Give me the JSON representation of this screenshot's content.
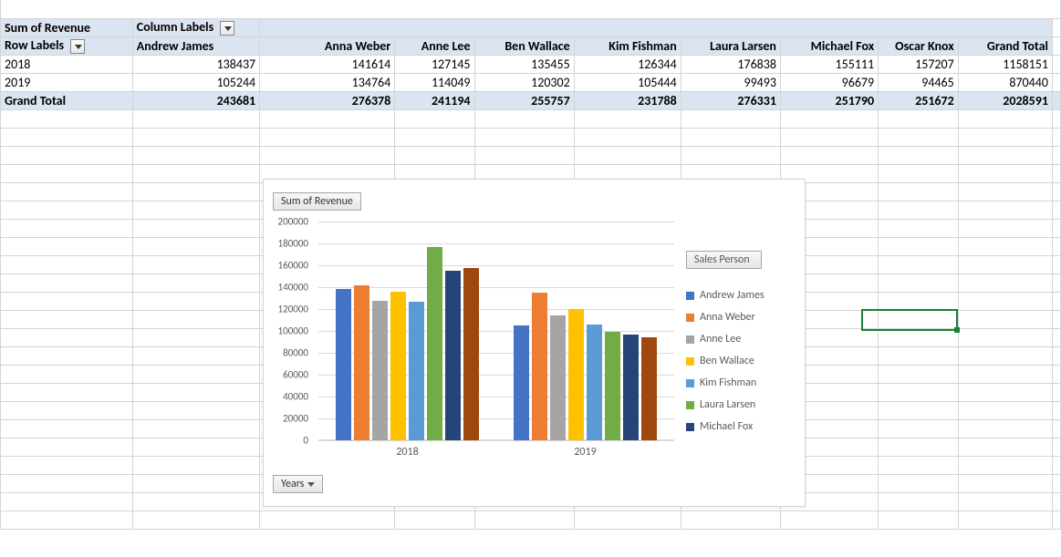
{
  "pivot": {
    "corner_label": "Sum of Revenue",
    "column_labels_header": "Column Labels",
    "row_labels_header": "Row Labels",
    "columns": [
      "Andrew James",
      "Anna Weber",
      "Anne Lee",
      "Ben Wallace",
      "Kim Fishman",
      "Laura Larsen",
      "Michael Fox",
      "Oscar Knox",
      "Grand Total"
    ],
    "rows": [
      {
        "label": "2018",
        "values": [
          138437,
          141614,
          127145,
          135455,
          126344,
          176838,
          155111,
          157207,
          1158151
        ]
      },
      {
        "label": "2019",
        "values": [
          105244,
          134764,
          114049,
          120302,
          105444,
          99493,
          96679,
          94465,
          870440
        ]
      }
    ],
    "grand_total_label": "Grand Total",
    "grand_total_values": [
      243681,
      276378,
      241194,
      255757,
      231788,
      276331,
      251790,
      251672,
      2028591
    ]
  },
  "chart_ui": {
    "value_field_button": "Sum of Revenue",
    "axis_field_button": "Years",
    "legend_header": "Sales Person"
  },
  "chart_data": {
    "type": "bar",
    "categories": [
      "2018",
      "2019"
    ],
    "series": [
      {
        "name": "Andrew James",
        "color": "#4472c4",
        "values": [
          138437,
          105244
        ]
      },
      {
        "name": "Anna Weber",
        "color": "#ed7d31",
        "values": [
          141614,
          134764
        ]
      },
      {
        "name": "Anne Lee",
        "color": "#a5a5a5",
        "values": [
          127145,
          114049
        ]
      },
      {
        "name": "Ben Wallace",
        "color": "#ffc000",
        "values": [
          135455,
          120302
        ]
      },
      {
        "name": "Kim Fishman",
        "color": "#5b9bd5",
        "values": [
          126344,
          105444
        ]
      },
      {
        "name": "Laura Larsen",
        "color": "#70ad47",
        "values": [
          176838,
          99493
        ]
      },
      {
        "name": "Michael Fox",
        "color": "#264478",
        "values": [
          155111,
          96679
        ]
      },
      {
        "name": "Oscar Knox",
        "color": "#9e480e",
        "values": [
          157207,
          94465
        ]
      }
    ],
    "ylim": [
      0,
      200000
    ],
    "ystep": 20000,
    "legend_visible_count": 7,
    "title": "",
    "xlabel": "",
    "ylabel": ""
  }
}
